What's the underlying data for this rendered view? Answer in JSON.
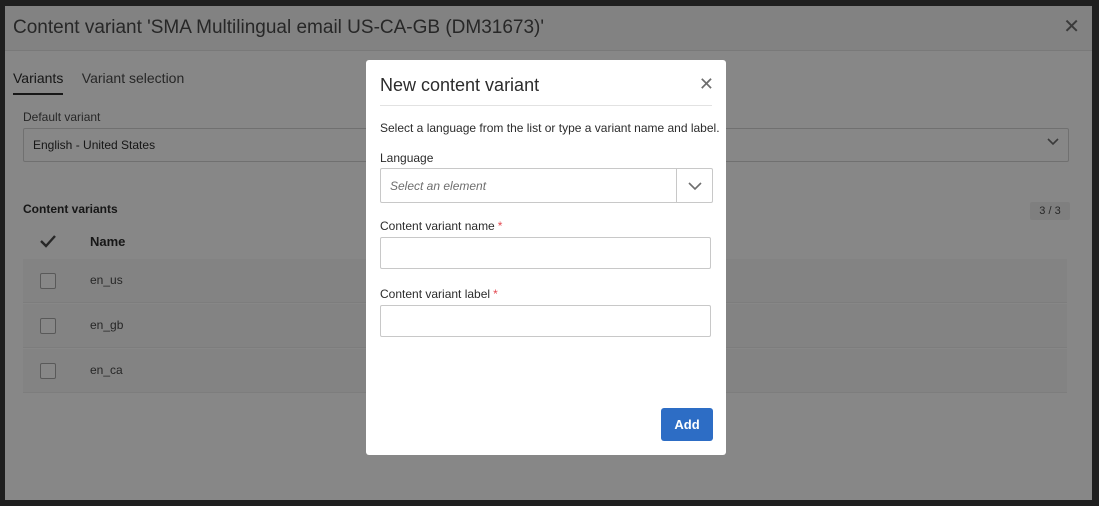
{
  "panel": {
    "title": "Content variant 'SMA Multilingual email US-CA-GB (DM31673)'",
    "tabs": [
      {
        "label": "Variants",
        "active": true
      },
      {
        "label": "Variant selection",
        "active": false
      }
    ],
    "default_variant": {
      "label": "Default variant",
      "value": "English - United States"
    },
    "content_variants": {
      "title": "Content variants",
      "count": "3 / 3",
      "column_name": "Name",
      "rows": [
        {
          "name": "en_us"
        },
        {
          "name": "en_gb"
        },
        {
          "name": "en_ca"
        }
      ]
    }
  },
  "dialog": {
    "title": "New content variant",
    "description": "Select a language from the list or type a variant name and label.",
    "language": {
      "label": "Language",
      "placeholder": "Select an element"
    },
    "variant_name": {
      "label": "Content variant name",
      "required_mark": "*",
      "value": ""
    },
    "variant_label": {
      "label": "Content variant label",
      "required_mark": "*",
      "value": ""
    },
    "add_label": "Add"
  },
  "colors": {
    "primary_button": "#2d6dc5",
    "required": "#e34850"
  }
}
